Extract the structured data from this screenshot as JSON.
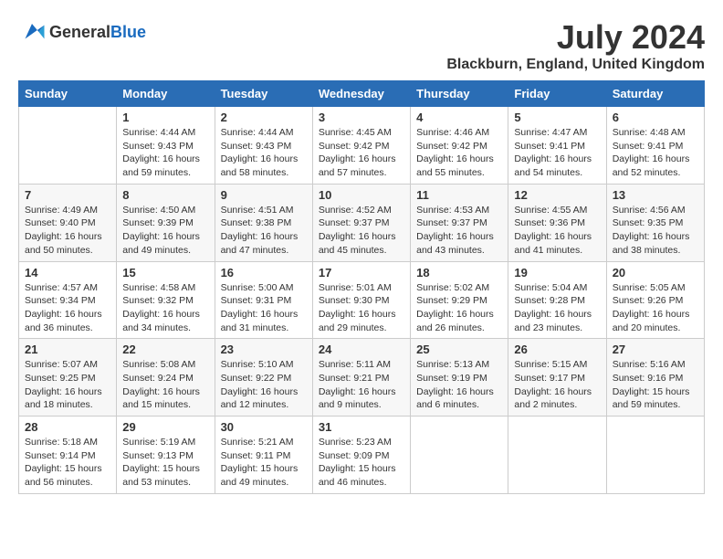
{
  "header": {
    "logo_general": "General",
    "logo_blue": "Blue",
    "month_year": "July 2024",
    "location": "Blackburn, England, United Kingdom"
  },
  "weekdays": [
    "Sunday",
    "Monday",
    "Tuesday",
    "Wednesday",
    "Thursday",
    "Friday",
    "Saturday"
  ],
  "weeks": [
    [
      {
        "day": null
      },
      {
        "day": 1,
        "sunrise": "4:44 AM",
        "sunset": "9:43 PM",
        "daylight": "16 hours and 59 minutes."
      },
      {
        "day": 2,
        "sunrise": "4:44 AM",
        "sunset": "9:43 PM",
        "daylight": "16 hours and 58 minutes."
      },
      {
        "day": 3,
        "sunrise": "4:45 AM",
        "sunset": "9:42 PM",
        "daylight": "16 hours and 57 minutes."
      },
      {
        "day": 4,
        "sunrise": "4:46 AM",
        "sunset": "9:42 PM",
        "daylight": "16 hours and 55 minutes."
      },
      {
        "day": 5,
        "sunrise": "4:47 AM",
        "sunset": "9:41 PM",
        "daylight": "16 hours and 54 minutes."
      },
      {
        "day": 6,
        "sunrise": "4:48 AM",
        "sunset": "9:41 PM",
        "daylight": "16 hours and 52 minutes."
      }
    ],
    [
      {
        "day": 7,
        "sunrise": "4:49 AM",
        "sunset": "9:40 PM",
        "daylight": "16 hours and 50 minutes."
      },
      {
        "day": 8,
        "sunrise": "4:50 AM",
        "sunset": "9:39 PM",
        "daylight": "16 hours and 49 minutes."
      },
      {
        "day": 9,
        "sunrise": "4:51 AM",
        "sunset": "9:38 PM",
        "daylight": "16 hours and 47 minutes."
      },
      {
        "day": 10,
        "sunrise": "4:52 AM",
        "sunset": "9:37 PM",
        "daylight": "16 hours and 45 minutes."
      },
      {
        "day": 11,
        "sunrise": "4:53 AM",
        "sunset": "9:37 PM",
        "daylight": "16 hours and 43 minutes."
      },
      {
        "day": 12,
        "sunrise": "4:55 AM",
        "sunset": "9:36 PM",
        "daylight": "16 hours and 41 minutes."
      },
      {
        "day": 13,
        "sunrise": "4:56 AM",
        "sunset": "9:35 PM",
        "daylight": "16 hours and 38 minutes."
      }
    ],
    [
      {
        "day": 14,
        "sunrise": "4:57 AM",
        "sunset": "9:34 PM",
        "daylight": "16 hours and 36 minutes."
      },
      {
        "day": 15,
        "sunrise": "4:58 AM",
        "sunset": "9:32 PM",
        "daylight": "16 hours and 34 minutes."
      },
      {
        "day": 16,
        "sunrise": "5:00 AM",
        "sunset": "9:31 PM",
        "daylight": "16 hours and 31 minutes."
      },
      {
        "day": 17,
        "sunrise": "5:01 AM",
        "sunset": "9:30 PM",
        "daylight": "16 hours and 29 minutes."
      },
      {
        "day": 18,
        "sunrise": "5:02 AM",
        "sunset": "9:29 PM",
        "daylight": "16 hours and 26 minutes."
      },
      {
        "day": 19,
        "sunrise": "5:04 AM",
        "sunset": "9:28 PM",
        "daylight": "16 hours and 23 minutes."
      },
      {
        "day": 20,
        "sunrise": "5:05 AM",
        "sunset": "9:26 PM",
        "daylight": "16 hours and 20 minutes."
      }
    ],
    [
      {
        "day": 21,
        "sunrise": "5:07 AM",
        "sunset": "9:25 PM",
        "daylight": "16 hours and 18 minutes."
      },
      {
        "day": 22,
        "sunrise": "5:08 AM",
        "sunset": "9:24 PM",
        "daylight": "16 hours and 15 minutes."
      },
      {
        "day": 23,
        "sunrise": "5:10 AM",
        "sunset": "9:22 PM",
        "daylight": "16 hours and 12 minutes."
      },
      {
        "day": 24,
        "sunrise": "5:11 AM",
        "sunset": "9:21 PM",
        "daylight": "16 hours and 9 minutes."
      },
      {
        "day": 25,
        "sunrise": "5:13 AM",
        "sunset": "9:19 PM",
        "daylight": "16 hours and 6 minutes."
      },
      {
        "day": 26,
        "sunrise": "5:15 AM",
        "sunset": "9:17 PM",
        "daylight": "16 hours and 2 minutes."
      },
      {
        "day": 27,
        "sunrise": "5:16 AM",
        "sunset": "9:16 PM",
        "daylight": "15 hours and 59 minutes."
      }
    ],
    [
      {
        "day": 28,
        "sunrise": "5:18 AM",
        "sunset": "9:14 PM",
        "daylight": "15 hours and 56 minutes."
      },
      {
        "day": 29,
        "sunrise": "5:19 AM",
        "sunset": "9:13 PM",
        "daylight": "15 hours and 53 minutes."
      },
      {
        "day": 30,
        "sunrise": "5:21 AM",
        "sunset": "9:11 PM",
        "daylight": "15 hours and 49 minutes."
      },
      {
        "day": 31,
        "sunrise": "5:23 AM",
        "sunset": "9:09 PM",
        "daylight": "15 hours and 46 minutes."
      },
      {
        "day": null
      },
      {
        "day": null
      },
      {
        "day": null
      }
    ]
  ]
}
